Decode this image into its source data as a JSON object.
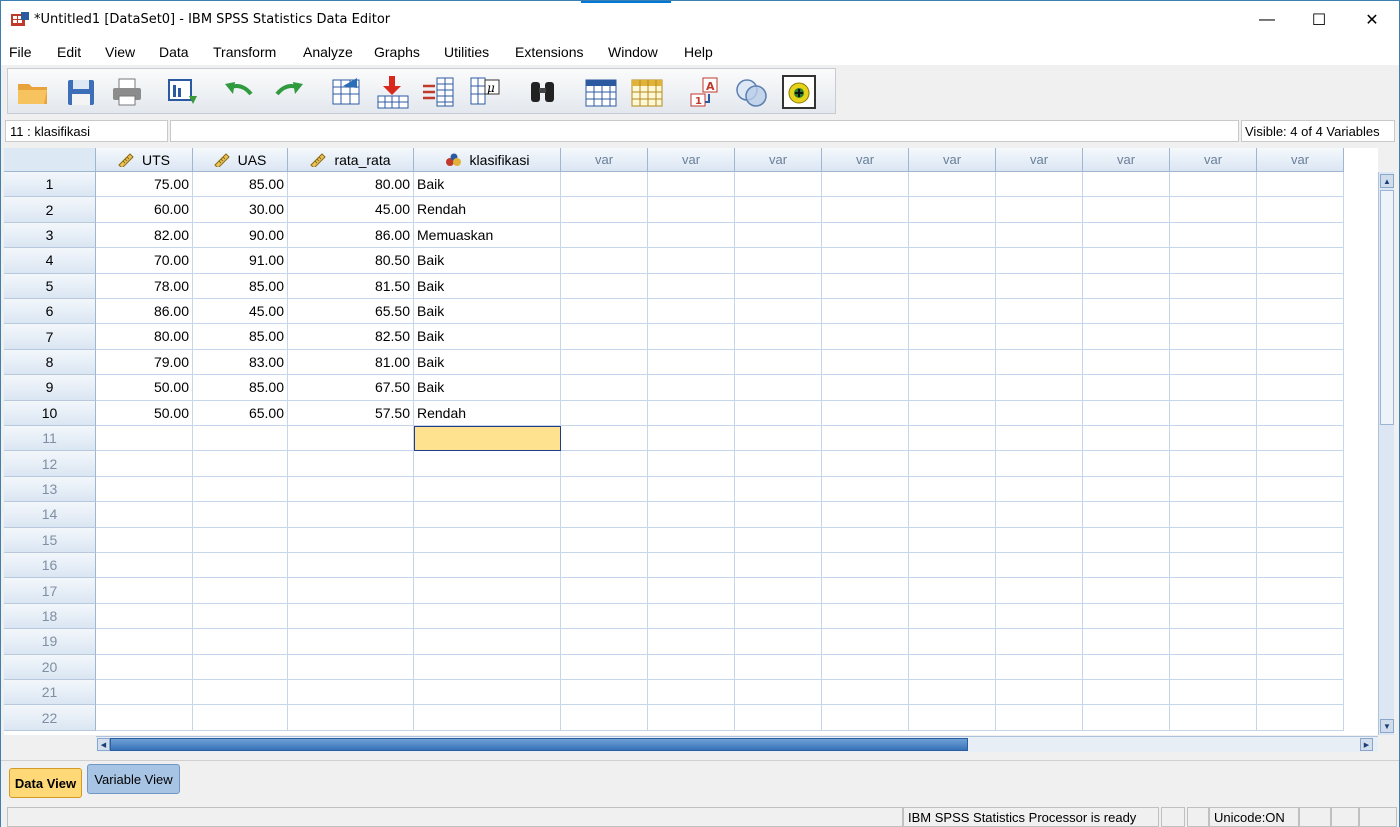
{
  "window": {
    "title": "*Untitled1 [DataSet0] - IBM SPSS Statistics Data Editor",
    "minimize_glyph": "—",
    "maximize_glyph": "☐",
    "close_glyph": "✕"
  },
  "menu": {
    "items": [
      "File",
      "Edit",
      "View",
      "Data",
      "Transform",
      "Analyze",
      "Graphs",
      "Utilities",
      "Extensions",
      "Window",
      "Help"
    ]
  },
  "toolbar": {
    "icons": [
      "open-folder-icon",
      "save-icon",
      "print-icon",
      "recall-dialog-icon",
      "undo-icon",
      "redo-icon",
      "go-to-case-icon",
      "go-to-variable-icon",
      "variables-icon",
      "value-labels-icon",
      "find-icon",
      "insert-cases-icon",
      "insert-variable-icon",
      "split-file-icon",
      "select-cases-icon",
      "use-sets-icon",
      "spelling-icon"
    ]
  },
  "refbar": {
    "cell_reference": "11 : klasifikasi",
    "cell_value": "",
    "visible_label": "Visible: 4 of 4 Variables"
  },
  "grid": {
    "columns": [
      {
        "name": "UTS",
        "type": "scale"
      },
      {
        "name": "UAS",
        "type": "scale"
      },
      {
        "name": "rata_rata",
        "type": "scale"
      },
      {
        "name": "klasifikasi",
        "type": "nominal"
      },
      {
        "name": "var",
        "type": "empty"
      },
      {
        "name": "var",
        "type": "empty"
      },
      {
        "name": "var",
        "type": "empty"
      },
      {
        "name": "var",
        "type": "empty"
      },
      {
        "name": "var",
        "type": "empty"
      },
      {
        "name": "var",
        "type": "empty"
      },
      {
        "name": "var",
        "type": "empty"
      },
      {
        "name": "var",
        "type": "empty"
      },
      {
        "name": "var",
        "type": "empty"
      }
    ],
    "rows": [
      {
        "n": "1",
        "UTS": "75.00",
        "UAS": "85.00",
        "rata_rata": "80.00",
        "klasifikasi": "Baik"
      },
      {
        "n": "2",
        "UTS": "60.00",
        "UAS": "30.00",
        "rata_rata": "45.00",
        "klasifikasi": "Rendah"
      },
      {
        "n": "3",
        "UTS": "82.00",
        "UAS": "90.00",
        "rata_rata": "86.00",
        "klasifikasi": "Memuaskan"
      },
      {
        "n": "4",
        "UTS": "70.00",
        "UAS": "91.00",
        "rata_rata": "80.50",
        "klasifikasi": "Baik"
      },
      {
        "n": "5",
        "UTS": "78.00",
        "UAS": "85.00",
        "rata_rata": "81.50",
        "klasifikasi": "Baik"
      },
      {
        "n": "6",
        "UTS": "86.00",
        "UAS": "45.00",
        "rata_rata": "65.50",
        "klasifikasi": "Baik"
      },
      {
        "n": "7",
        "UTS": "80.00",
        "UAS": "85.00",
        "rata_rata": "82.50",
        "klasifikasi": "Baik"
      },
      {
        "n": "8",
        "UTS": "79.00",
        "UAS": "83.00",
        "rata_rata": "81.00",
        "klasifikasi": "Baik"
      },
      {
        "n": "9",
        "UTS": "50.00",
        "UAS": "85.00",
        "rata_rata": "67.50",
        "klasifikasi": "Baik"
      },
      {
        "n": "10",
        "UTS": "50.00",
        "UAS": "65.00",
        "rata_rata": "57.50",
        "klasifikasi": "Rendah"
      }
    ],
    "empty_rows": [
      "11",
      "12",
      "13",
      "14",
      "15",
      "16",
      "17",
      "18",
      "19",
      "20",
      "21",
      "22"
    ],
    "selected_cell": {
      "row": "11",
      "column": "klasifikasi"
    }
  },
  "tabs": {
    "data_view": "Data View",
    "variable_view": "Variable View"
  },
  "status": {
    "processor": "IBM SPSS Statistics Processor is ready",
    "unicode": "Unicode:ON"
  },
  "colors": {
    "selected_cell": "#ffe28f",
    "header_blue": "#dbe6f3",
    "active_tab": "#ffd978",
    "inactive_tab": "#a7c4e4"
  }
}
